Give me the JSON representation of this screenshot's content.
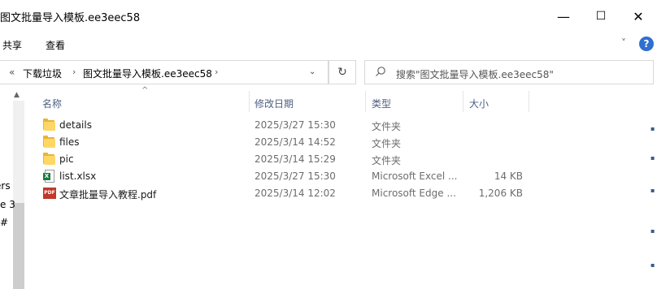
{
  "window": {
    "title": "图文批量导入模板.ee3eec58",
    "minimize": "—",
    "maximize": "☐",
    "close": "✕"
  },
  "ribbon": {
    "tabs": [
      "共享",
      "查看"
    ],
    "expand_glyph": "˅",
    "help_glyph": "?"
  },
  "address": {
    "history_glyph": "«",
    "crumbs": [
      "下载垃圾",
      "图文批量导入模板.ee3eec58"
    ],
    "separator": "›",
    "dropdown_glyph": "⌄",
    "refresh_glyph": "↻"
  },
  "search": {
    "placeholder": "搜索\"图文批量导入模板.ee3eec58\"",
    "icon": "search-icon"
  },
  "navpane": {
    "items": [
      "ers",
      "e 3",
      "#"
    ]
  },
  "columns": {
    "name": "名称",
    "date": "修改日期",
    "type": "类型",
    "size": "大小",
    "sort_glyph": "^"
  },
  "files": [
    {
      "name": "details",
      "date": "2025/3/27 15:30",
      "type": "文件夹",
      "size": "",
      "icon": "folder-icon"
    },
    {
      "name": "files",
      "date": "2025/3/14 14:52",
      "type": "文件夹",
      "size": "",
      "icon": "folder-icon"
    },
    {
      "name": "pic",
      "date": "2025/3/14 15:29",
      "type": "文件夹",
      "size": "",
      "icon": "folder-icon"
    },
    {
      "name": "list.xlsx",
      "date": "2025/3/27 15:30",
      "type": "Microsoft Excel ...",
      "size": "14 KB",
      "icon": "excel-file-icon"
    },
    {
      "name": "文章批量导入教程.pdf",
      "date": "2025/3/14 12:02",
      "type": "Microsoft Edge ...",
      "size": "1,206 KB",
      "icon": "pdf-file-icon"
    }
  ],
  "colors": {
    "folder": "#ffd766",
    "excel": "#1d7a44",
    "pdf": "#c0392b",
    "header_text": "#4d6082"
  }
}
